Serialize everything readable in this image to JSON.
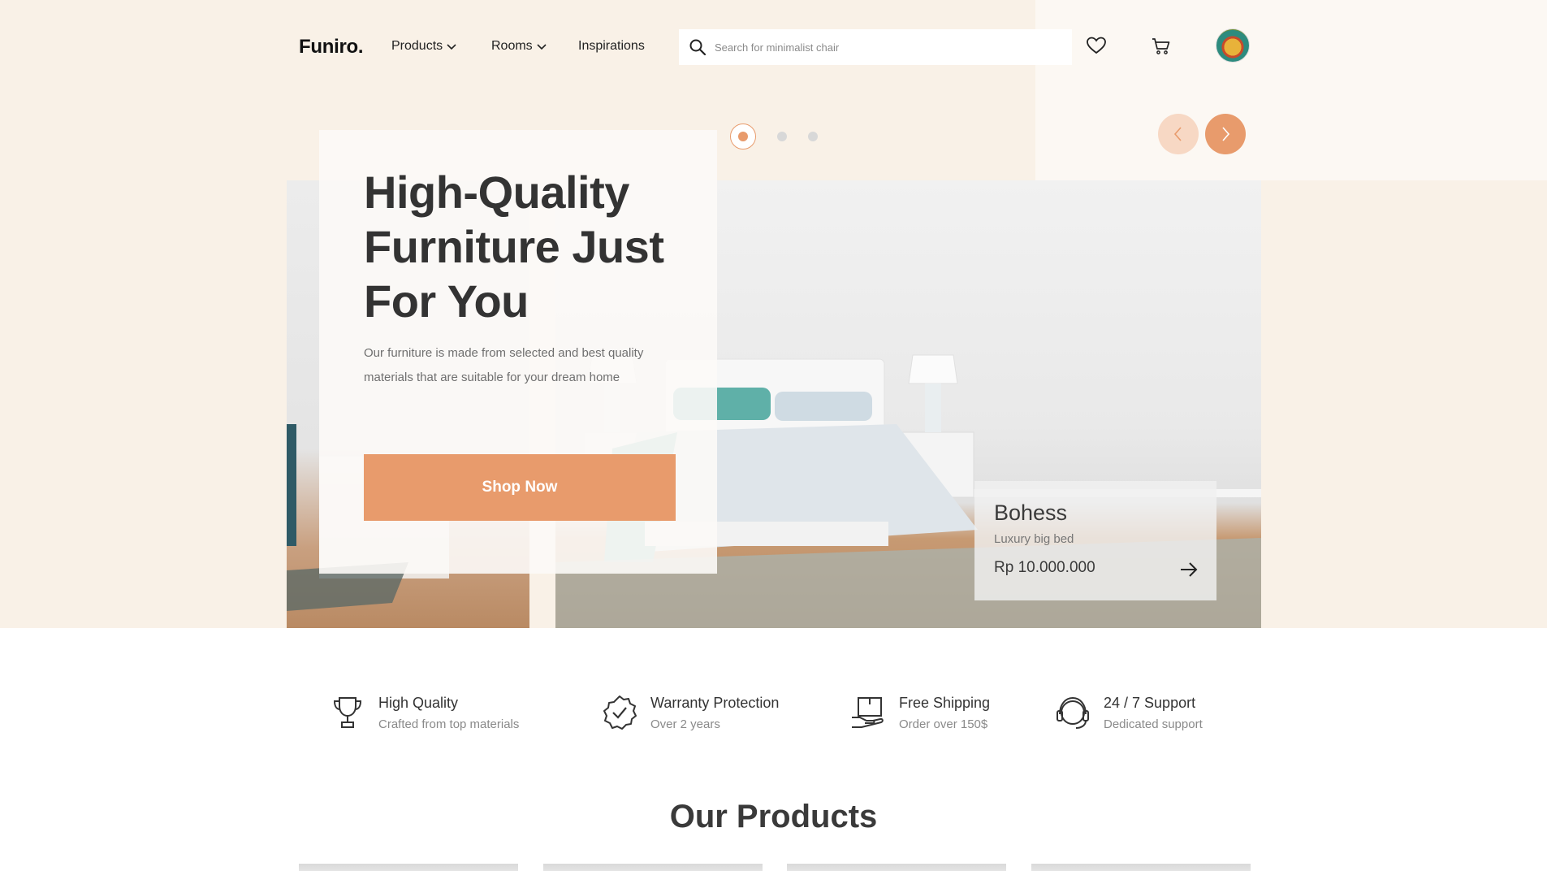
{
  "header": {
    "logo": "Funiro.",
    "nav": [
      {
        "label": "Products",
        "has_dropdown": true
      },
      {
        "label": "Rooms",
        "has_dropdown": true
      },
      {
        "label": "Inspirations",
        "has_dropdown": false
      }
    ],
    "search": {
      "placeholder": "Search for minimalist chair",
      "value": "",
      "icon": "search-icon"
    },
    "icons": [
      "heart-icon",
      "cart-icon"
    ],
    "avatar_alt": "user-avatar"
  },
  "slider": {
    "dots": 3,
    "active_index": 0
  },
  "hero": {
    "title": "High-Quality Furniture Just For You",
    "description": "Our furniture is made from selected and best quality materials that are suitable for your dream home",
    "cta": "Shop Now"
  },
  "featured_product": {
    "name": "Bohess",
    "subtitle": "Luxury big bed",
    "price": "Rp 10.000.000"
  },
  "features": [
    {
      "icon": "trophy-icon",
      "title": "High Quality",
      "subtitle": "Crafted from top materials"
    },
    {
      "icon": "warranty-badge-icon",
      "title": "Warranty Protection",
      "subtitle": "Over 2 years"
    },
    {
      "icon": "shipping-box-icon",
      "title": "Free Shipping",
      "subtitle": "Order over 150$"
    },
    {
      "icon": "support-headset-icon",
      "title": "24 / 7 Support",
      "subtitle": "Dedicated support"
    }
  ],
  "products_section": {
    "title": "Our Products"
  },
  "colors": {
    "accent": "#e89b6c",
    "accent_light": "#f7d8c4",
    "hero_bg": "#f9f1e7",
    "text_dark": "#333333",
    "text_muted": "#8a8a8a"
  }
}
